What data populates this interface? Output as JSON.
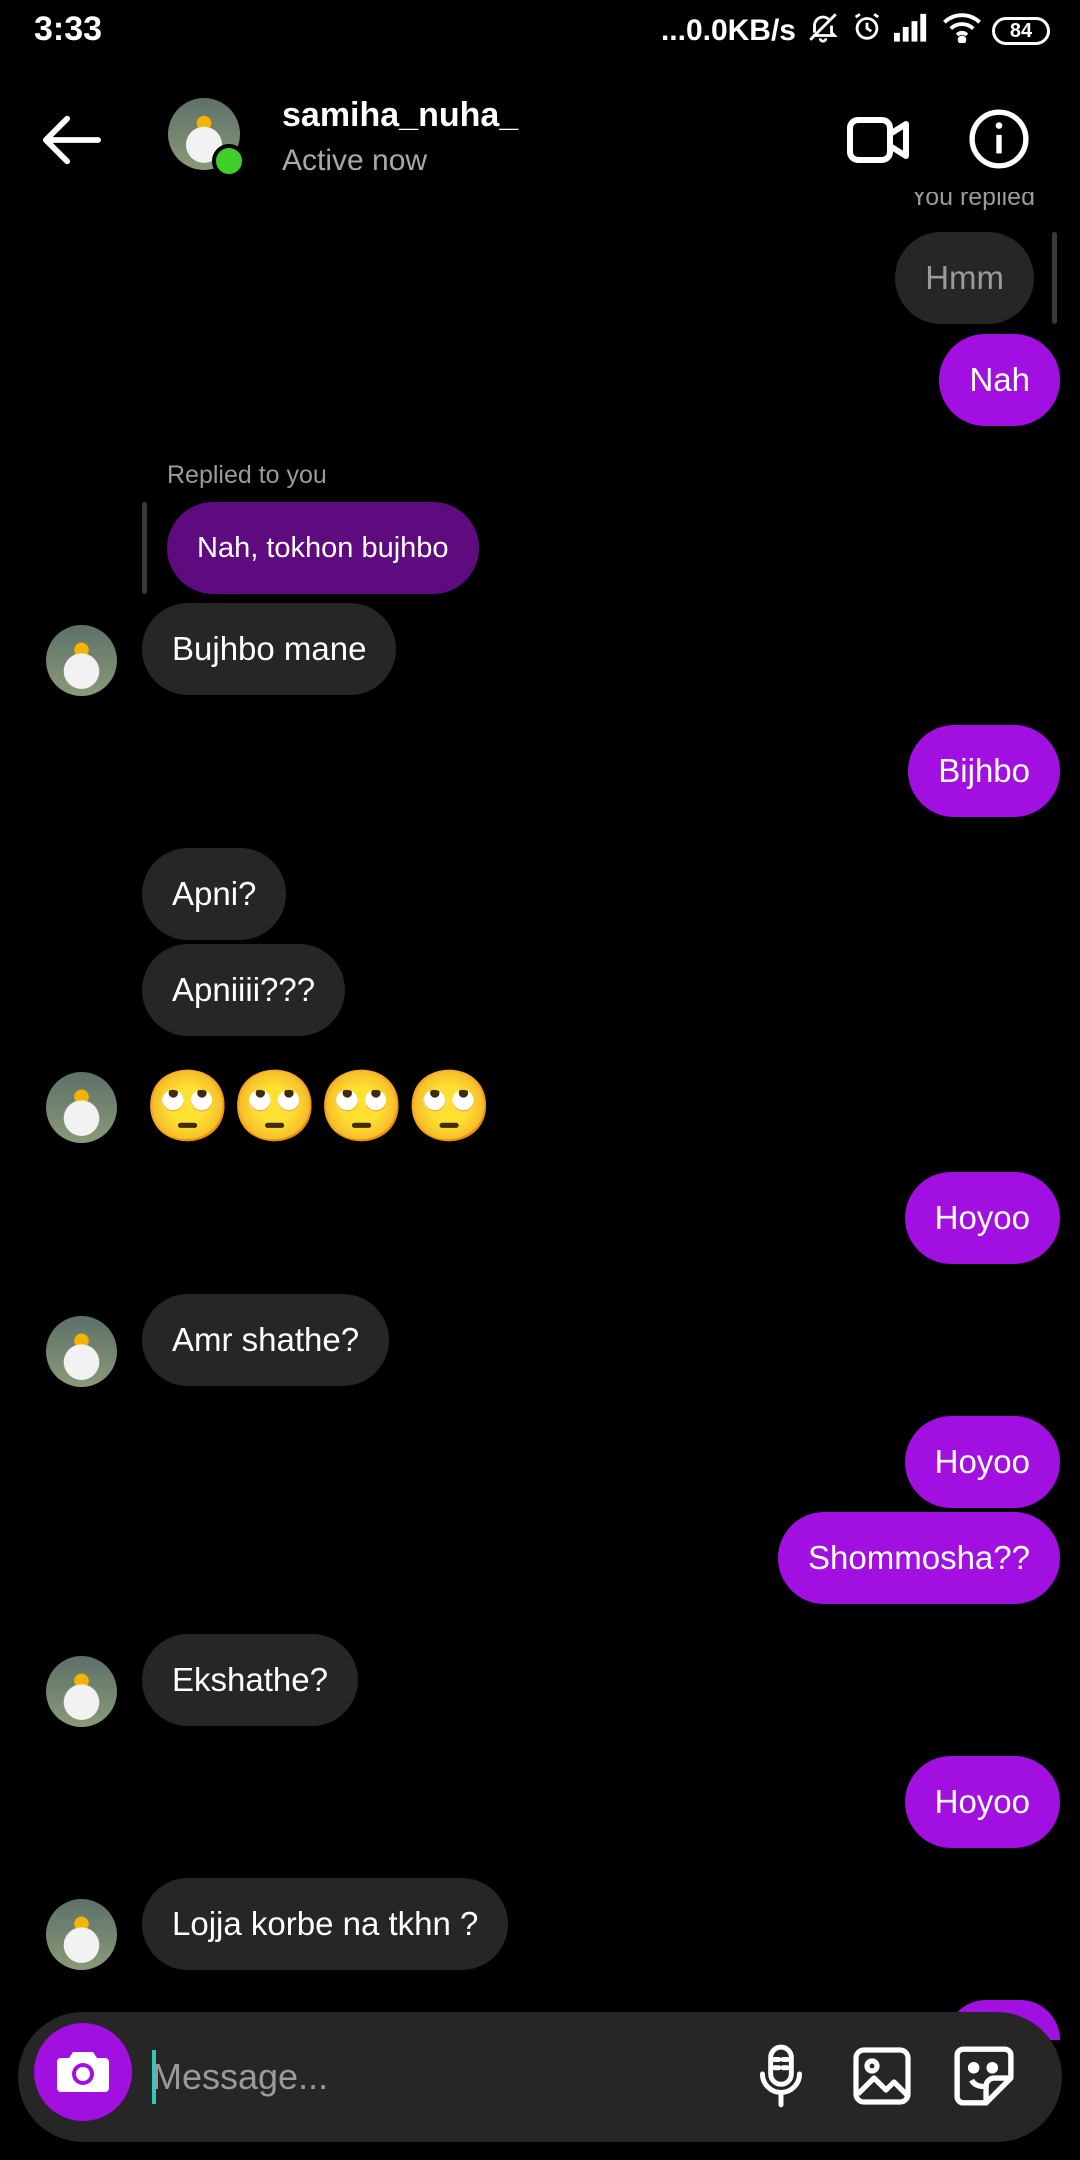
{
  "status_bar": {
    "time": "3:33",
    "net_speed": "...0.0KB/s",
    "battery": "84"
  },
  "header": {
    "username": "samiha_nuha_",
    "status": "Active now"
  },
  "labels": {
    "you_replied": "You replied",
    "replied_to_you": "Replied to you"
  },
  "messages": {
    "m1": "Hmm",
    "m2": "Nah",
    "m3": "Nah, tokhon bujhbo",
    "m4": "Bujhbo mane",
    "m5": "Bijhbo",
    "m6": "Apni?",
    "m7": "Apniiii???",
    "m8": "🙄🙄🙄🙄",
    "m9": "Hoyoo",
    "m10": "Amr shathe?",
    "m11": "Hoyoo",
    "m12": "Shommosha??",
    "m13": "Ekshathe?",
    "m14": "Hoyoo",
    "m15": "Lojja korbe na tkhn ?"
  },
  "composer": {
    "placeholder": "Message..."
  },
  "colors": {
    "accent": "#a10fe1",
    "bubble_in": "#262626",
    "online": "#3fcf2a"
  }
}
